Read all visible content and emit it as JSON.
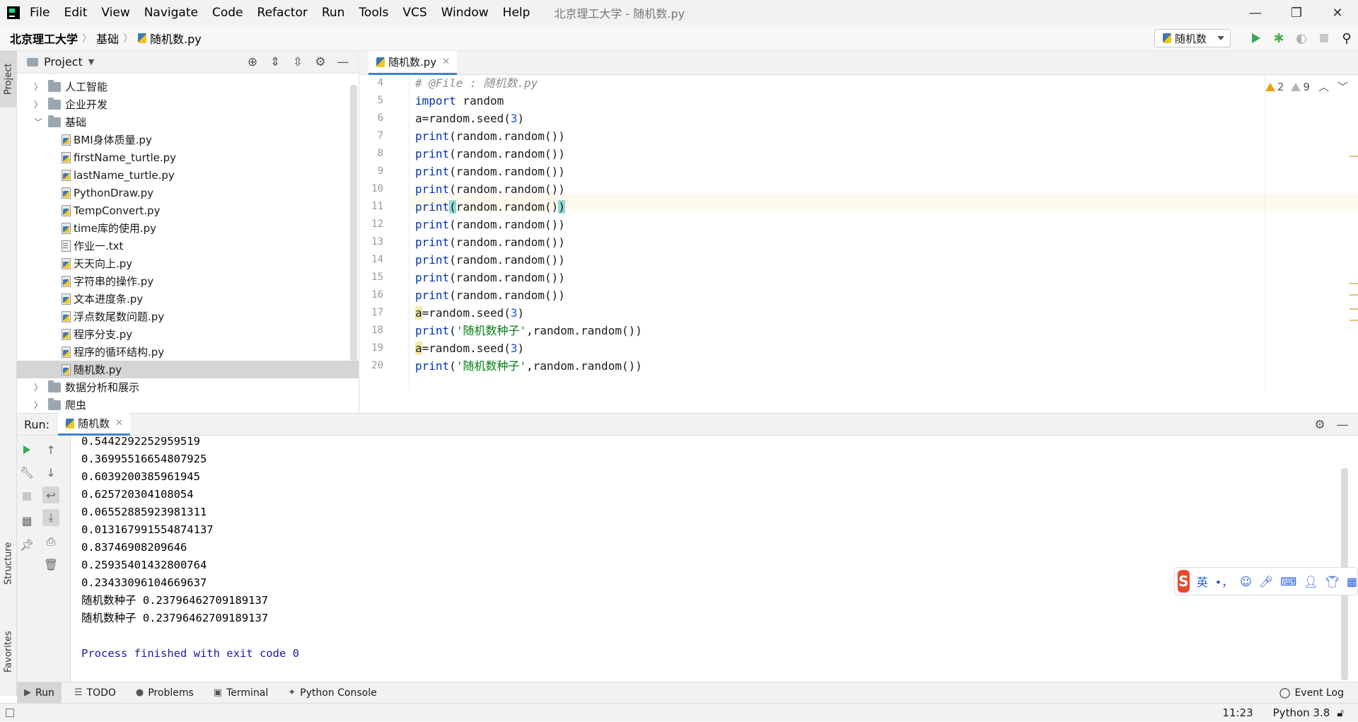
{
  "menubar": {
    "items": [
      "File",
      "Edit",
      "View",
      "Navigate",
      "Code",
      "Refactor",
      "Run",
      "Tools",
      "VCS",
      "Window",
      "Help"
    ],
    "window_title": "北京理工大学 - 随机数.py",
    "controls": {
      "minimize": "—",
      "restore": "❐",
      "close": "✕"
    }
  },
  "navbar": {
    "breadcrumbs": [
      "北京理工大学",
      "基础",
      "随机数.py"
    ],
    "run_config": "随机数"
  },
  "project_panel": {
    "title": "Project",
    "tree": [
      {
        "label": "人工智能",
        "type": "folder",
        "expanded": false,
        "indent": 1
      },
      {
        "label": "企业开发",
        "type": "folder",
        "expanded": false,
        "indent": 1
      },
      {
        "label": "基础",
        "type": "folder",
        "expanded": true,
        "indent": 1
      },
      {
        "label": "BMI身体质量.py",
        "type": "py",
        "indent": 2
      },
      {
        "label": "firstName_turtle.py",
        "type": "py",
        "indent": 2
      },
      {
        "label": "lastName_turtle.py",
        "type": "py",
        "indent": 2
      },
      {
        "label": "PythonDraw.py",
        "type": "py",
        "indent": 2
      },
      {
        "label": "TempConvert.py",
        "type": "py",
        "indent": 2
      },
      {
        "label": "time库的使用.py",
        "type": "py",
        "indent": 2
      },
      {
        "label": "作业一.txt",
        "type": "txt",
        "indent": 2
      },
      {
        "label": "天天向上.py",
        "type": "py",
        "indent": 2
      },
      {
        "label": "字符串的操作.py",
        "type": "py",
        "indent": 2
      },
      {
        "label": "文本进度条.py",
        "type": "py",
        "indent": 2
      },
      {
        "label": "浮点数尾数问题.py",
        "type": "py",
        "indent": 2
      },
      {
        "label": "程序分支.py",
        "type": "py",
        "indent": 2
      },
      {
        "label": "程序的循环结构.py",
        "type": "py",
        "indent": 2
      },
      {
        "label": "随机数.py",
        "type": "py",
        "indent": 2,
        "selected": true
      },
      {
        "label": "数据分析和展示",
        "type": "folder",
        "expanded": false,
        "indent": 1
      },
      {
        "label": "爬虫",
        "type": "folder",
        "expanded": false,
        "indent": 1
      }
    ]
  },
  "editor": {
    "tab_label": "随机数.py",
    "warnings": {
      "yellow": "2",
      "gray": "9"
    },
    "lines": [
      {
        "no": "4",
        "text": "# @File : 随机数.py"
      },
      {
        "no": "5",
        "text": "import random"
      },
      {
        "no": "6",
        "text": "a=random.seed(3)"
      },
      {
        "no": "7",
        "text": "print(random.random())"
      },
      {
        "no": "8",
        "text": "print(random.random())"
      },
      {
        "no": "9",
        "text": "print(random.random())"
      },
      {
        "no": "10",
        "text": "print(random.random())"
      },
      {
        "no": "11",
        "text": "print(random.random())"
      },
      {
        "no": "12",
        "text": "print(random.random())"
      },
      {
        "no": "13",
        "text": "print(random.random())"
      },
      {
        "no": "14",
        "text": "print(random.random())"
      },
      {
        "no": "15",
        "text": "print(random.random())"
      },
      {
        "no": "16",
        "text": "print(random.random())"
      },
      {
        "no": "17",
        "text": "a=random.seed(3)"
      },
      {
        "no": "18",
        "text": "print('随机数种子',random.random())"
      },
      {
        "no": "19",
        "text": "a=random.seed(3)"
      },
      {
        "no": "20",
        "text": "print('随机数种子',random.random())"
      }
    ]
  },
  "run_panel": {
    "label": "Run:",
    "tab_label": "随机数",
    "output": [
      "0.5442292252959519",
      "0.36995516654807925",
      "0.6039200385961945",
      "0.625720304108054",
      "0.06552885923981311",
      "0.013167991554874137",
      "0.83746908209646",
      "0.25935401432800764",
      "0.23433096104669637",
      "随机数种子 0.23796462709189137",
      "随机数种子 0.23796462709189137",
      "",
      "Process finished with exit code 0"
    ]
  },
  "side_tabs": {
    "project": "Project",
    "structure": "Structure",
    "favorites": "Favorites"
  },
  "tool_tabs": [
    "Run",
    "TODO",
    "Problems",
    "Terminal",
    "Python Console"
  ],
  "event_log": "Event Log",
  "status": {
    "position": "11:23",
    "interpreter": "Python 3.8"
  },
  "ime": {
    "lang": "英",
    "punct": "•，"
  }
}
